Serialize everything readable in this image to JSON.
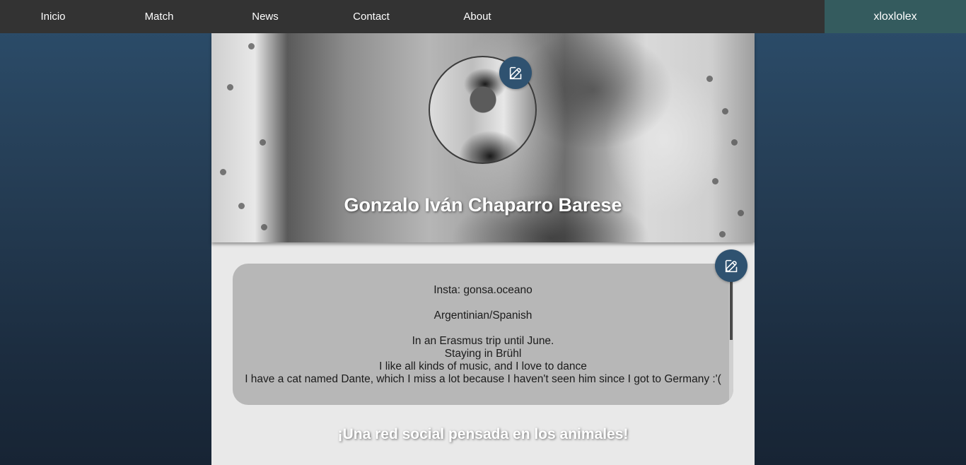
{
  "nav": {
    "items": [
      {
        "label": "Inicio"
      },
      {
        "label": "Match"
      },
      {
        "label": "News"
      },
      {
        "label": "Contact"
      },
      {
        "label": "About"
      }
    ],
    "username": "xloxlolex"
  },
  "profile": {
    "name": "Gonzalo Iván Chaparro Barese",
    "bio_lines": [
      "Insta: gonsa.oceano",
      "",
      "Argentinian/Spanish",
      "",
      "In an Erasmus trip until June.",
      "Staying in Brühl",
      "I like all kinds of music, and I love to dance",
      "I have a cat named Dante, which I miss a lot because I haven't seen him since I got to Germany :'("
    ]
  },
  "tagline": "¡Una red social pensada en los animales!",
  "icons": {
    "edit_avatar": "edit-icon",
    "edit_bio": "edit-icon"
  },
  "colors": {
    "navbar": "#333333",
    "user_badge": "#345b5e",
    "accent": "#2f5270",
    "bio_box": "#b7b7b7",
    "content_bg": "#e9e9e9"
  }
}
